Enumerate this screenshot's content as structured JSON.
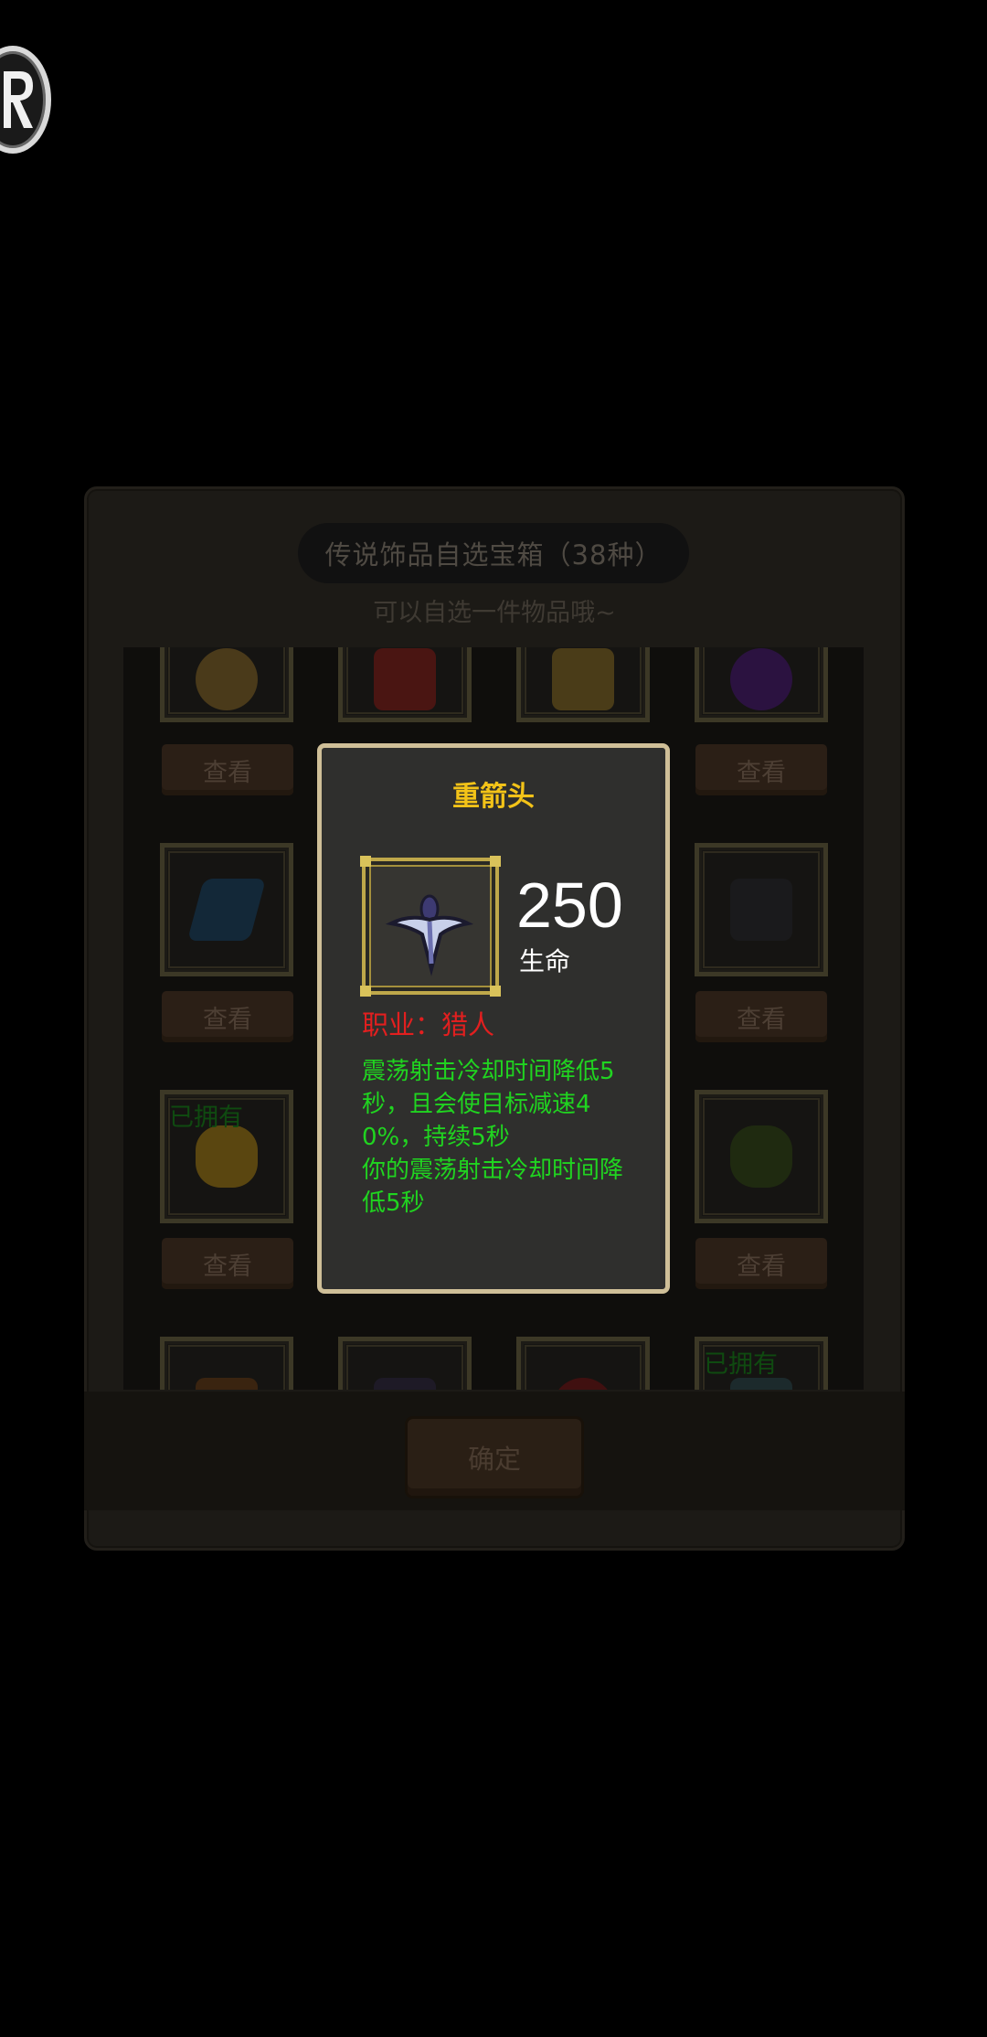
{
  "corner_icon": "r-logo-icon",
  "chest": {
    "title": "传说饰品自选宝箱（38种）",
    "subtitle": "可以自选一件物品哦~",
    "view_label": "查看",
    "owned_label": "已拥有",
    "confirm_label": "确定",
    "items": [
      {
        "icon": "lion-medallion-icon"
      },
      {
        "icon": "red-book-icon"
      },
      {
        "icon": "golden-bell-icon"
      },
      {
        "icon": "purple-gem-icon"
      },
      {
        "icon": "blue-crystal-shards-icon"
      },
      {
        "icon": "black-claw-icon"
      },
      {
        "icon": "gold-nugget-icon",
        "owned": true
      },
      {
        "icon": "green-skull-icon"
      },
      {
        "icon": "orange-feather-icon"
      },
      {
        "icon": "dark-horn-icon"
      },
      {
        "icon": "red-orb-icon"
      },
      {
        "icon": "silver-ore-icon",
        "owned": true
      }
    ]
  },
  "tooltip": {
    "title": "重箭头",
    "icon": "arrowhead-icon",
    "stat_value": "250",
    "stat_name": "生命",
    "class_text": "职业：猎人",
    "desc_line1": "震荡射击冷却时间降低5秒，且会使目标减速40%，持续5秒",
    "desc_line2": "你的震荡射击冷却时间降低5秒"
  },
  "colors": {
    "tooltip_title": "#f3c318",
    "class_text": "#e21f1f",
    "description": "#20d420",
    "tooltip_border": "#cfbf98"
  }
}
